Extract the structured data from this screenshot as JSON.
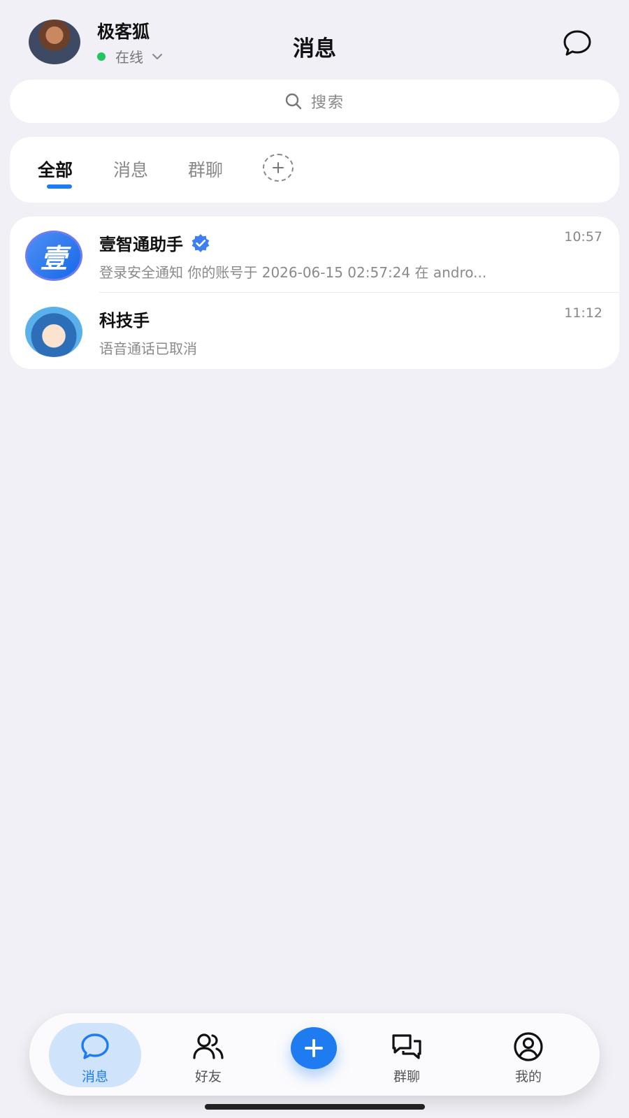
{
  "header": {
    "user_name": "极客狐",
    "status_text": "在线",
    "title": "消息"
  },
  "search": {
    "placeholder": "搜索"
  },
  "tabs": [
    {
      "label": "全部",
      "active": true
    },
    {
      "label": "消息",
      "active": false
    },
    {
      "label": "群聊",
      "active": false
    }
  ],
  "chats": [
    {
      "name": "壹智通助手",
      "verified": true,
      "avatar_glyph": "壹",
      "preview": "登录安全通知 你的账号于 2026-06-15 02:57:24 在 andro...",
      "time": "10:57"
    },
    {
      "name": "科技手",
      "verified": false,
      "preview": "语音通话已取消",
      "time": "11:12"
    }
  ],
  "bottom_nav": {
    "messages": "消息",
    "friends": "好友",
    "groups": "群聊",
    "mine": "我的"
  },
  "colors": {
    "accent": "#1e7bf0",
    "online": "#22c55e",
    "background": "#f0f0f6",
    "active_nav_bg": "#cfe3fb"
  },
  "icons": {
    "compose": "chat-bubble-icon",
    "search": "search-icon",
    "tab_add": "plus-icon",
    "verified": "verified-badge-icon",
    "nav_messages": "chat-bubble-icon",
    "nav_friends": "users-icon",
    "nav_add": "plus-icon",
    "nav_groups": "group-chat-icon",
    "nav_mine": "user-circle-icon"
  }
}
